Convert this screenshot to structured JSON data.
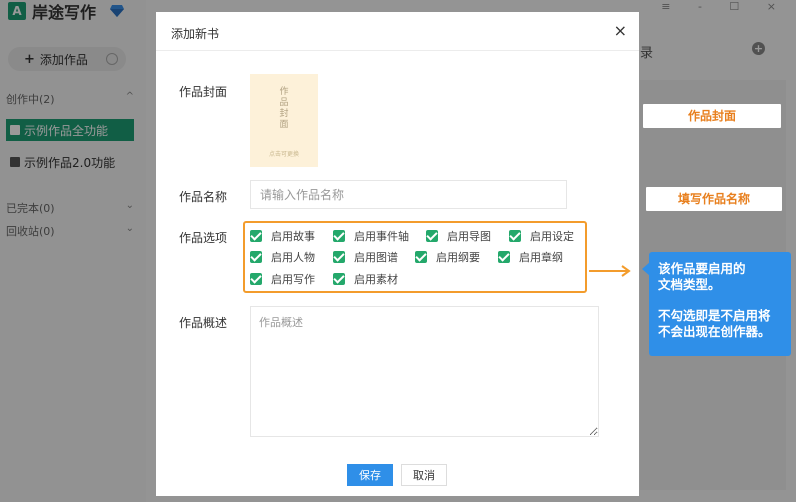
{
  "app": {
    "title": "岸途写作",
    "logo_mark": "A",
    "window_controls": "≡ - ☐ ×"
  },
  "sidebar": {
    "add_work_label": "添加作品",
    "add_plus": "+",
    "groups": [
      {
        "label": "创作中",
        "count": "(2)",
        "chevron": "^"
      },
      {
        "label": "已完本",
        "count": "(0)",
        "chevron": "⌄"
      },
      {
        "label": "回收站",
        "count": "(0)",
        "chevron": "⌄"
      }
    ],
    "works": [
      {
        "label": "示例作品全功能",
        "active": true
      },
      {
        "label": "示例作品2.0功能",
        "active": false
      }
    ]
  },
  "right_panel": {
    "title_fragment": "录",
    "plus": "+"
  },
  "dialog": {
    "title": "添加新书",
    "close": "×",
    "cover_label": "作品封面",
    "cover_text": [
      "作",
      "品",
      "封",
      "面"
    ],
    "cover_hint": "点击可更换",
    "name_label": "作品名称",
    "name_placeholder": "请输入作品名称",
    "name_value": "",
    "options_label": "作品选项",
    "options": [
      {
        "label": "启用故事",
        "checked": true
      },
      {
        "label": "启用事件轴",
        "checked": true
      },
      {
        "label": "启用导图",
        "checked": true
      },
      {
        "label": "启用设定",
        "checked": true
      },
      {
        "label": "启用人物",
        "checked": true
      },
      {
        "label": "启用图谱",
        "checked": true
      },
      {
        "label": "启用纲要",
        "checked": true
      },
      {
        "label": "启用章纲",
        "checked": true
      },
      {
        "label": "启用写作",
        "checked": true
      },
      {
        "label": "启用素材",
        "checked": true
      }
    ],
    "desc_label": "作品概述",
    "desc_placeholder": "作品概述",
    "save_label": "保存",
    "cancel_label": "取消"
  },
  "callouts": {
    "cover": "作品封面",
    "name": "填写作品名称",
    "options_line1": "该作品要启用的",
    "options_line2": "文档类型。",
    "options_line3": "不勾选即是不启用将",
    "options_line4": "不会出现在创作器。"
  },
  "colors": {
    "brand_green": "#1d9d74",
    "checkbox_green": "#24a86b",
    "accent_orange": "#f39c2c",
    "callout_orange_text": "#e8801f",
    "primary_blue": "#2f8fe8",
    "cover_bg": "#fdf1d9"
  }
}
